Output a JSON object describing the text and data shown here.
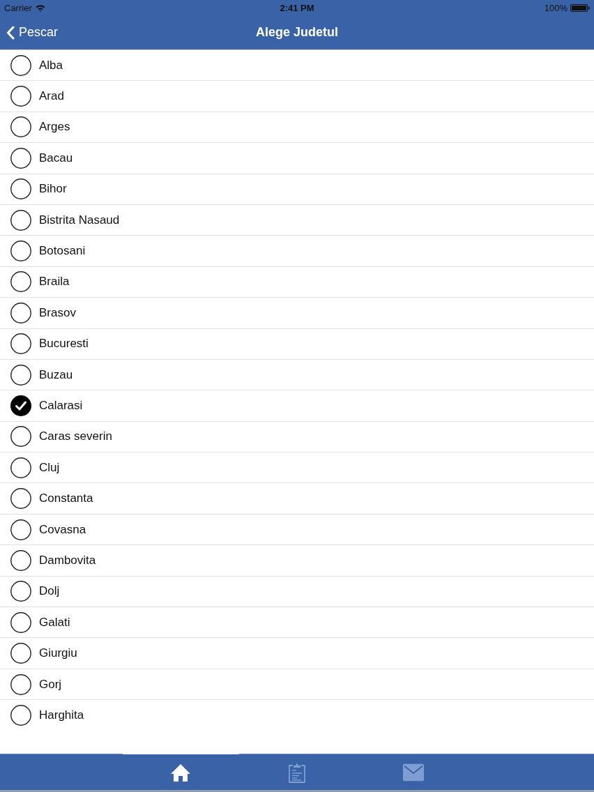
{
  "status_bar": {
    "carrier": "Carrier",
    "time": "2:41 PM",
    "battery": "100%"
  },
  "nav_bar": {
    "back": "Pescar",
    "title": "Alege Judetul"
  },
  "counties": [
    {
      "name": "Alba",
      "selected": false
    },
    {
      "name": "Arad",
      "selected": false
    },
    {
      "name": "Arges",
      "selected": false
    },
    {
      "name": "Bacau",
      "selected": false
    },
    {
      "name": "Bihor",
      "selected": false
    },
    {
      "name": "Bistrita Nasaud",
      "selected": false
    },
    {
      "name": "Botosani",
      "selected": false
    },
    {
      "name": "Braila",
      "selected": false
    },
    {
      "name": "Brasov",
      "selected": false
    },
    {
      "name": "Bucuresti",
      "selected": false
    },
    {
      "name": "Buzau",
      "selected": false
    },
    {
      "name": "Calarasi",
      "selected": true
    },
    {
      "name": "Caras severin",
      "selected": false
    },
    {
      "name": "Cluj",
      "selected": false
    },
    {
      "name": "Constanta",
      "selected": false
    },
    {
      "name": "Covasna",
      "selected": false
    },
    {
      "name": "Dambovita",
      "selected": false
    },
    {
      "name": "Dolj",
      "selected": false
    },
    {
      "name": "Galati",
      "selected": false
    },
    {
      "name": "Giurgiu",
      "selected": false
    },
    {
      "name": "Gorj",
      "selected": false
    },
    {
      "name": "Harghita",
      "selected": false
    }
  ],
  "tab_bar": {
    "tabs": [
      {
        "kind": "home",
        "selected": true
      },
      {
        "kind": "clipboard",
        "selected": false
      },
      {
        "kind": "mail",
        "selected": false
      }
    ]
  }
}
